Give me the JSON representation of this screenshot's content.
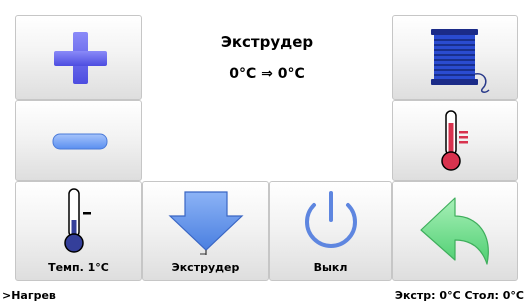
{
  "header": {
    "title": "Экструдер",
    "temperature": "0°C ⇒ 0°C"
  },
  "buttons": {
    "increase": {
      "icon": "plus-icon"
    },
    "decrease": {
      "icon": "minus-icon"
    },
    "filament": {
      "icon": "filament-spool-icon"
    },
    "heat": {
      "icon": "thermometer-hot-icon"
    },
    "temp_step": {
      "label": "Темп. 1°C",
      "icon": "thermometer-cold-icon"
    },
    "extruder": {
      "label": "Экструдер",
      "icon": "extruder-nozzle-icon"
    },
    "off": {
      "label": "Выкл",
      "icon": "power-icon"
    },
    "back": {
      "icon": "back-arrow-icon"
    }
  },
  "status": {
    "left": ">Нагрев",
    "right": "Экстр: 0°C  Стол: 0°C"
  },
  "colors": {
    "plus": "#6b6bf0",
    "minus": "#7ea6f6",
    "spool": "#1b2b88",
    "hot": "#d8324e",
    "cold": "#343f9a",
    "extruder": "#5b8de8",
    "power": "#5e86e0",
    "arrow": "#6fe08c"
  }
}
